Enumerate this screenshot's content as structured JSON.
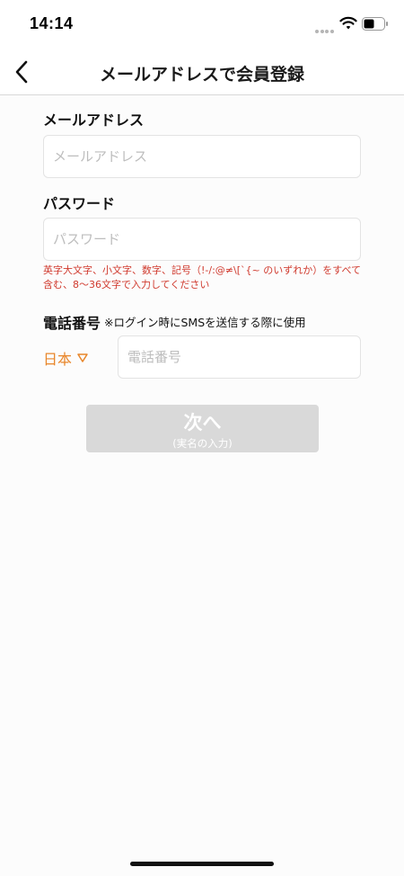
{
  "status": {
    "time": "14:14"
  },
  "nav": {
    "title": "メールアドレスで会員登録"
  },
  "email": {
    "label": "メールアドレス",
    "placeholder": "メールアドレス",
    "value": ""
  },
  "password": {
    "label": "パスワード",
    "placeholder": "パスワード",
    "value": "",
    "hint": "英字大文字、小文字、数字、記号（!-/:@≠\\[`{~ のいずれか）をすべて含む、8～36文字で入力してください"
  },
  "phone": {
    "label": "電話番号",
    "note": "※ログイン時にSMSを送信する際に使用",
    "country": "日本",
    "placeholder": "電話番号",
    "value": ""
  },
  "next_button": {
    "label": "次へ",
    "sublabel": "(実名の入力)"
  },
  "colors": {
    "accent": "#e8862a",
    "error": "#d03a2e",
    "disabled_button": "#d9d9d9"
  }
}
